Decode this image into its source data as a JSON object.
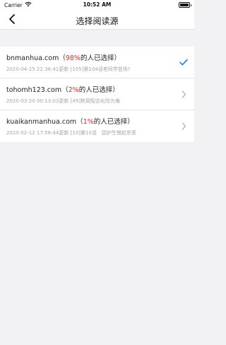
{
  "status_bar": {
    "carrier": "Carrier",
    "time": "10:52 AM"
  },
  "nav": {
    "title": "选择阅读源"
  },
  "sources": [
    {
      "domain": "bnmanhua.com",
      "open_paren": "（",
      "percent": "98%",
      "suffix": "的人已选择）",
      "subtitle": "2020-04-25 22:36:41更新 [105]第104话老同学登场?",
      "accessory": "checkmark-icon",
      "selected": true
    },
    {
      "domain": "tohomh123.com",
      "open_paren": "（",
      "percent": "2%",
      "suffix": "的人已选择）",
      "subtitle": "2020-03-20 00:13:03更新 [49]默契配合化险为夷",
      "accessory": "chevron-right-icon",
      "selected": false
    },
    {
      "domain": "kuaikanmanhua.com",
      "open_paren": "（",
      "percent": "1%",
      "suffix": "的人已选择）",
      "subtitle": "2020-02-12 17:56:44更新 [10]第10话　因护生恨起杀意",
      "accessory": "chevron-right-icon",
      "selected": false
    }
  ],
  "colors": {
    "accent_blue": "#1a7cf5",
    "percent_red": "#e8262a",
    "background": "#f2f2f4"
  }
}
